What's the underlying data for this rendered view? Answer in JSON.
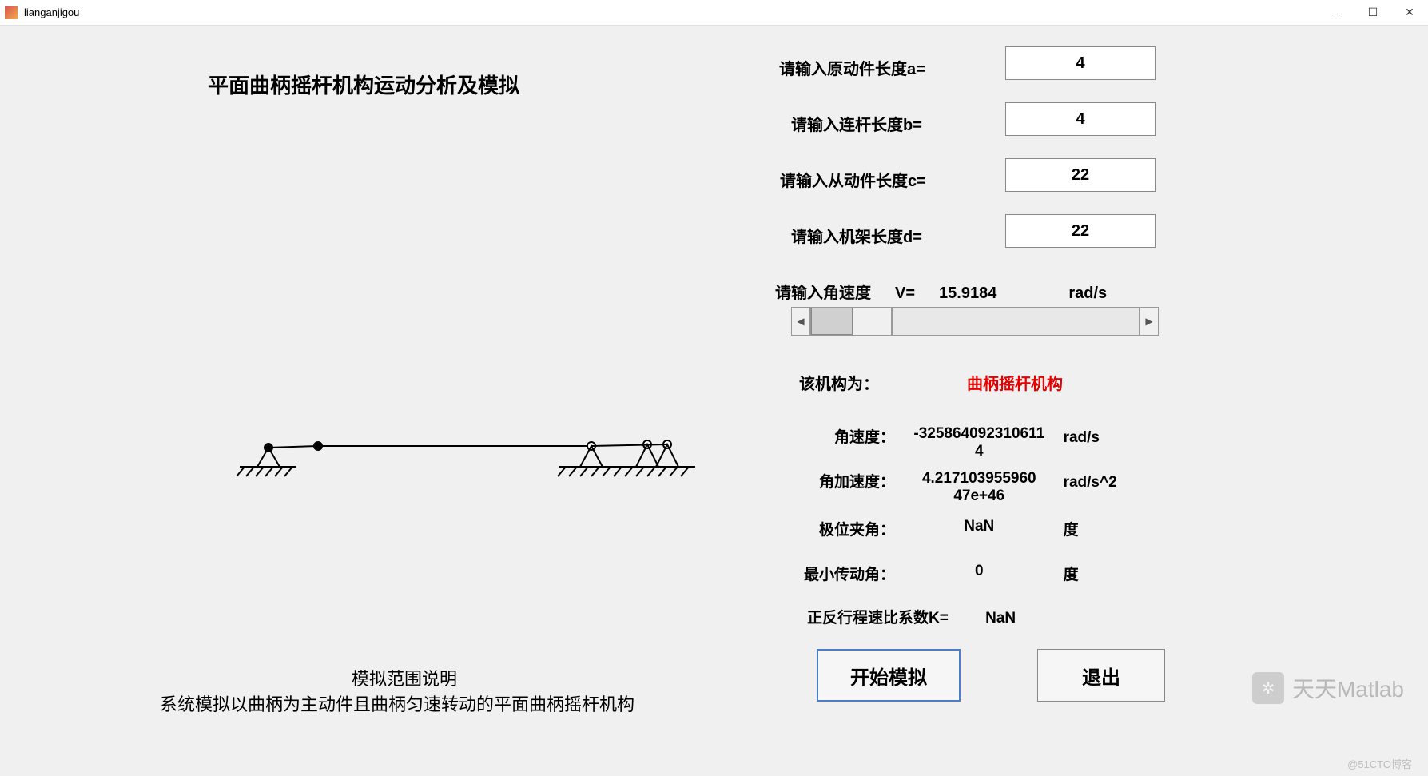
{
  "window": {
    "title": "lianganjigou"
  },
  "titles": {
    "main": "平面曲柄摇杆机构运动分析及模拟",
    "desc_title": "模拟范围说明",
    "desc_text": "系统模拟以曲柄为主动件且曲柄匀速转动的平面曲柄摇杆机构"
  },
  "params": {
    "label_a": "请输入原动件长度a=",
    "value_a": "4",
    "label_b": "请输入连杆长度b=",
    "value_b": "4",
    "label_c": "请输入从动件长度c=",
    "value_c": "22",
    "label_d": "请输入机架长度d=",
    "value_d": "22"
  },
  "angular": {
    "label": "请输入角速度",
    "symbol": "V=",
    "value": "15.9184",
    "unit": "rad/s"
  },
  "mech_type": {
    "label": "该机构为：",
    "value": "曲柄摇杆机构"
  },
  "outputs": {
    "vel_label": "角速度：",
    "vel_value": "-325864092310611\n4",
    "vel_unit": "rad/s",
    "acc_label": "角加速度：",
    "acc_value": "4.217103955960\n47e+46",
    "acc_unit": "rad/s^2",
    "ang_label": "极位夹角：",
    "ang_value": "NaN",
    "ang_unit": "度",
    "min_label": "最小传动角：",
    "min_value": "0",
    "min_unit": "度",
    "k_label": "正反行程速比系数K=",
    "k_value": "NaN"
  },
  "buttons": {
    "start": "开始模拟",
    "exit": "退出"
  },
  "watermark": {
    "text": "天天Matlab",
    "small": "@51CTO博客"
  }
}
